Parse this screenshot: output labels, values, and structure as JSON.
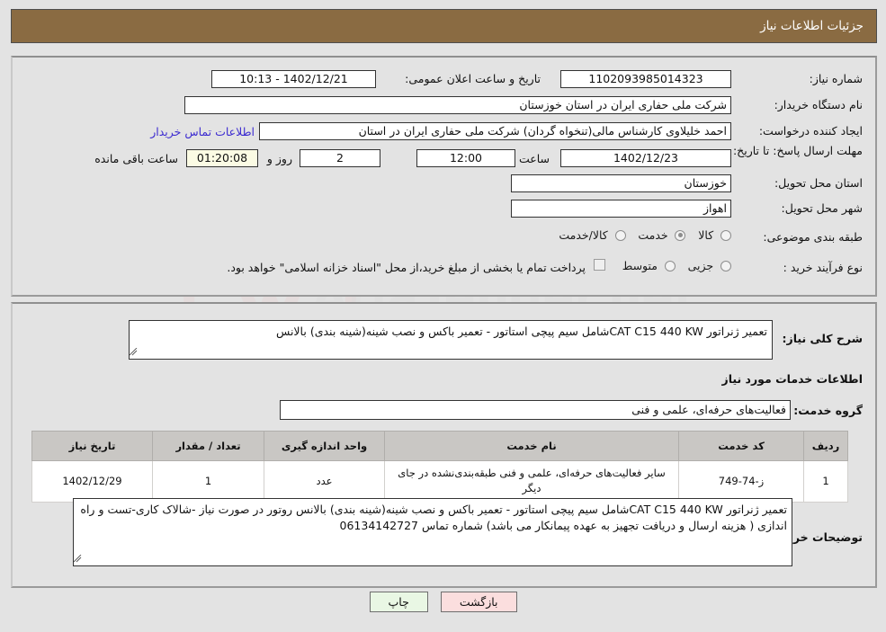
{
  "header": {
    "title": "جزئیات اطلاعات نیاز"
  },
  "info": {
    "need_number_label": "شماره نیاز:",
    "need_number_value": "1102093985014323",
    "announce_label": "تاریخ و ساعت اعلان عمومی:",
    "announce_value": "1402/12/21 - 10:13",
    "buyer_org_label": "نام دستگاه خریدار:",
    "buyer_org_value": "شرکت ملی حفاری ایران در استان خوزستان",
    "creator_label": "ایجاد کننده درخواست:",
    "creator_value": "احمد خلیلاوی کارشناس مالی(تنخواه گردان) شرکت ملی حفاری ایران در استان",
    "contact_link": "اطلاعات تماس خریدار",
    "deadline_label": "مهلت ارسال پاسخ: تا تاریخ:",
    "deadline_date": "1402/12/23",
    "time_label": "ساعت",
    "time_value": "12:00",
    "days_value": "2",
    "days_label": "روز و",
    "countdown_value": "01:20:08",
    "countdown_label": "ساعت باقی مانده",
    "province_label": "استان محل تحویل:",
    "province_value": "خوزستان",
    "city_label": "شهر محل تحویل:",
    "city_value": "اهواز",
    "category_label": "طبقه بندی موضوعی:",
    "category_options": [
      "کالا",
      "خدمت",
      "کالا/خدمت"
    ],
    "category_selected": "خدمت",
    "process_label": "نوع فرآیند خرید :",
    "process_options": [
      "جزیی",
      "متوسط"
    ],
    "process_selected": "",
    "treasury_note": "پرداخت تمام یا بخشی از مبلغ خرید،از محل \"اسناد خزانه اسلامی\" خواهد بود."
  },
  "desc": {
    "general_label": "شرح کلی نیاز:",
    "general_value": "تعمیر ژنراتور CAT C15 440 KWشامل سیم پیچی استاتور - تعمیر باکس و نصب شینه(شینه بندی) بالانس",
    "services_heading": "اطلاعات خدمات مورد نیاز",
    "group_label": "گروه خدمت:",
    "group_value": "فعالیت‌های حرفه‌ای، علمی و فنی",
    "buyer_notes_label": "توضیحات خریدار:",
    "buyer_notes_value": "تعمیر ژنراتور CAT C15 440 KWشامل سیم پیچی استاتور - تعمیر باکس و نصب شینه(شینه بندی) بالانس روتور در صورت نیاز -شالاک کاری-تست و راه اندازی ( هزینه ارسال و دریافت تجهیز به عهده پیمانکار می باشد) شماره تماس 06134142727"
  },
  "table": {
    "columns": [
      "ردیف",
      "کد خدمت",
      "نام خدمت",
      "واحد اندازه گیری",
      "تعداد / مقدار",
      "تاریخ نیاز"
    ],
    "rows": [
      {
        "row": "1",
        "code": "ز-74-749",
        "name": "سایر فعالیت‌های حرفه‌ای، علمی و فنی طبقه‌بندی‌نشده در جای دیگر",
        "unit": "عدد",
        "qty": "1",
        "date": "1402/12/29"
      }
    ]
  },
  "footer": {
    "print_label": "چاپ",
    "back_label": "بازگشت"
  },
  "colors": {
    "header_bg": "#8a6b42",
    "page_bg": "#e3e3e3",
    "link": "#3c2bd0",
    "countdown_bg": "#fbfbe4",
    "table_header_bg": "#c9c7c4",
    "btn_print_bg": "#e9f7e4",
    "btn_back_bg": "#fbdede"
  },
  "watermark": {
    "text": "AriaTender.net"
  }
}
